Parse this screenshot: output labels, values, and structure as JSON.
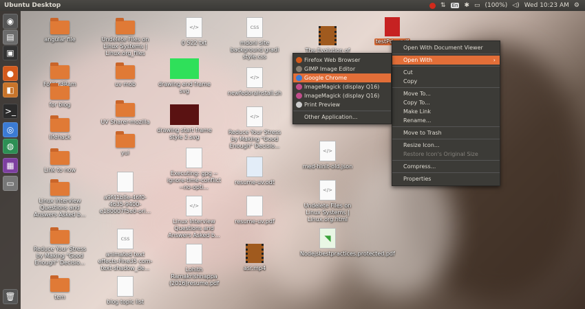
{
  "top_panel": {
    "title": "Ubuntu Desktop",
    "language": "En",
    "battery": "(100%)",
    "clock": "Wed 10:23 AM"
  },
  "launcher": [
    {
      "name": "dash-icon",
      "glyph": "◉",
      "color": "#555"
    },
    {
      "name": "files-icon",
      "glyph": "▤",
      "color": "#6b6b6b"
    },
    {
      "name": "terminal-system-icon",
      "glyph": "▣",
      "color": "#333"
    },
    {
      "name": "firefox-icon",
      "glyph": "●",
      "color": "#d35a1c"
    },
    {
      "name": "archive-icon",
      "glyph": "◧",
      "color": "#c8742a"
    },
    {
      "name": "terminal-icon",
      "glyph": ">_",
      "color": "#2b2b2b"
    },
    {
      "name": "chrome-icon",
      "glyph": "◎",
      "color": "#3b7bd4"
    },
    {
      "name": "globe-icon",
      "glyph": "◍",
      "color": "#2d8f54"
    },
    {
      "name": "video-icon",
      "glyph": "▦",
      "color": "#7d3fa0"
    },
    {
      "name": "drive-icon",
      "glyph": "▭",
      "color": "#777"
    },
    {
      "name": "trash-icon",
      "glyph": "🗑",
      "color": "#555"
    }
  ],
  "desktop_items": [
    {
      "label": "angular file",
      "type": "folder"
    },
    {
      "label": "Folder3Ram",
      "type": "folder"
    },
    {
      "label": "for blog",
      "type": "folder"
    },
    {
      "label": "lifehack",
      "type": "folder"
    },
    {
      "label": "Link to now",
      "type": "folder"
    },
    {
      "label": "Linux Interview Questions and Answers Asked b...",
      "type": "folder"
    },
    {
      "label": "Reduce Your Stress by Making \"Good Enough\" Decisio...",
      "type": "folder"
    },
    {
      "label": "tem",
      "type": "folder"
    },
    {
      "label": "Undelete Files on Linux Systems | Linux.org_files",
      "type": "folder"
    },
    {
      "label": "uv mob",
      "type": "folder"
    },
    {
      "label": "UV Sharer-mozilla",
      "type": "folder"
    },
    {
      "label": "yui",
      "type": "folder"
    },
    {
      "label": "a9f41b8e-46f0-4635-9400-e180007f5e0-ori...",
      "type": "doc"
    },
    {
      "label": "animated text effects-Fine35 com-text-shadow_de...",
      "type": "css"
    },
    {
      "label": "blog topic list",
      "type": "doc"
    },
    {
      "label": "0 522 txt",
      "type": "code"
    },
    {
      "label": "drawing end frame svg",
      "type": "thumb-green"
    },
    {
      "label": "drawing start frame style 2.svg",
      "type": "thumb-dark"
    },
    {
      "label": "Executing: gpg --ignore-time-conflict --no-opti...",
      "type": "doc"
    },
    {
      "label": "Linux Interview Questions and Answers Asked b...",
      "type": "code"
    },
    {
      "label": "Lohith Ramakrishnappa (2016)resume.pdf",
      "type": "doc"
    },
    {
      "label": "mdoni site background gradi style.css",
      "type": "css"
    },
    {
      "label": "newfedorainstall.sh",
      "type": "code"
    },
    {
      "label": "Reduce Your Stress by Making \"Good Enough\" Decisio...",
      "type": "code"
    },
    {
      "label": "resume-uv.odt",
      "type": "odt"
    },
    {
      "label": "resume-uv.pdf",
      "type": "doc"
    },
    {
      "label": "asr.mp4",
      "type": "video"
    },
    {
      "label": "The Evolution of ArangoDB 2.8.mp4",
      "type": "video"
    },
    {
      "label": "med-hinit-old.json",
      "type": "code"
    },
    {
      "label": "Undelete Files on Linux Systems | Linux.org.html",
      "type": "code"
    },
    {
      "label": "Nodejsbestpractices.protected.pdf",
      "type": "pdf-green"
    },
    {
      "label": "testPd....pdf",
      "type": "pdf-red"
    }
  ],
  "context_menu": {
    "items": [
      {
        "label": "Open With Document Viewer",
        "state": "normal"
      },
      {
        "sep": true
      },
      {
        "label": "Open With",
        "state": "highlight",
        "submenu": true
      },
      {
        "sep": true
      },
      {
        "label": "Cut",
        "state": "normal"
      },
      {
        "label": "Copy",
        "state": "normal"
      },
      {
        "sep": true
      },
      {
        "label": "Move To...",
        "state": "normal"
      },
      {
        "label": "Copy To...",
        "state": "normal"
      },
      {
        "label": "Make Link",
        "state": "normal"
      },
      {
        "label": "Rename...",
        "state": "normal"
      },
      {
        "sep": true
      },
      {
        "label": "Move to Trash",
        "state": "normal"
      },
      {
        "sep": true
      },
      {
        "label": "Resize Icon...",
        "state": "normal"
      },
      {
        "label": "Restore Icon's Original Size",
        "state": "disabled"
      },
      {
        "sep": true
      },
      {
        "label": "Compress...",
        "state": "normal"
      },
      {
        "sep": true
      },
      {
        "label": "Properties",
        "state": "normal"
      }
    ]
  },
  "submenu": {
    "items": [
      {
        "label": "Firefox Web Browser",
        "icon": "#d35a1c",
        "state": "normal"
      },
      {
        "label": "GIMP Image Editor",
        "icon": "#8a7f72",
        "state": "normal"
      },
      {
        "label": "Google Chrome",
        "icon": "#3b7bd4",
        "state": "highlight"
      },
      {
        "label": "ImageMagick (display Q16)",
        "icon": "#c14d8a",
        "state": "normal"
      },
      {
        "label": "ImageMagick (display Q16)",
        "icon": "#c14d8a",
        "state": "normal"
      },
      {
        "label": "Print Preview",
        "icon": "#ccc",
        "state": "normal"
      },
      {
        "sep": true
      },
      {
        "label": "Other Application...",
        "icon": "",
        "state": "normal"
      }
    ]
  }
}
